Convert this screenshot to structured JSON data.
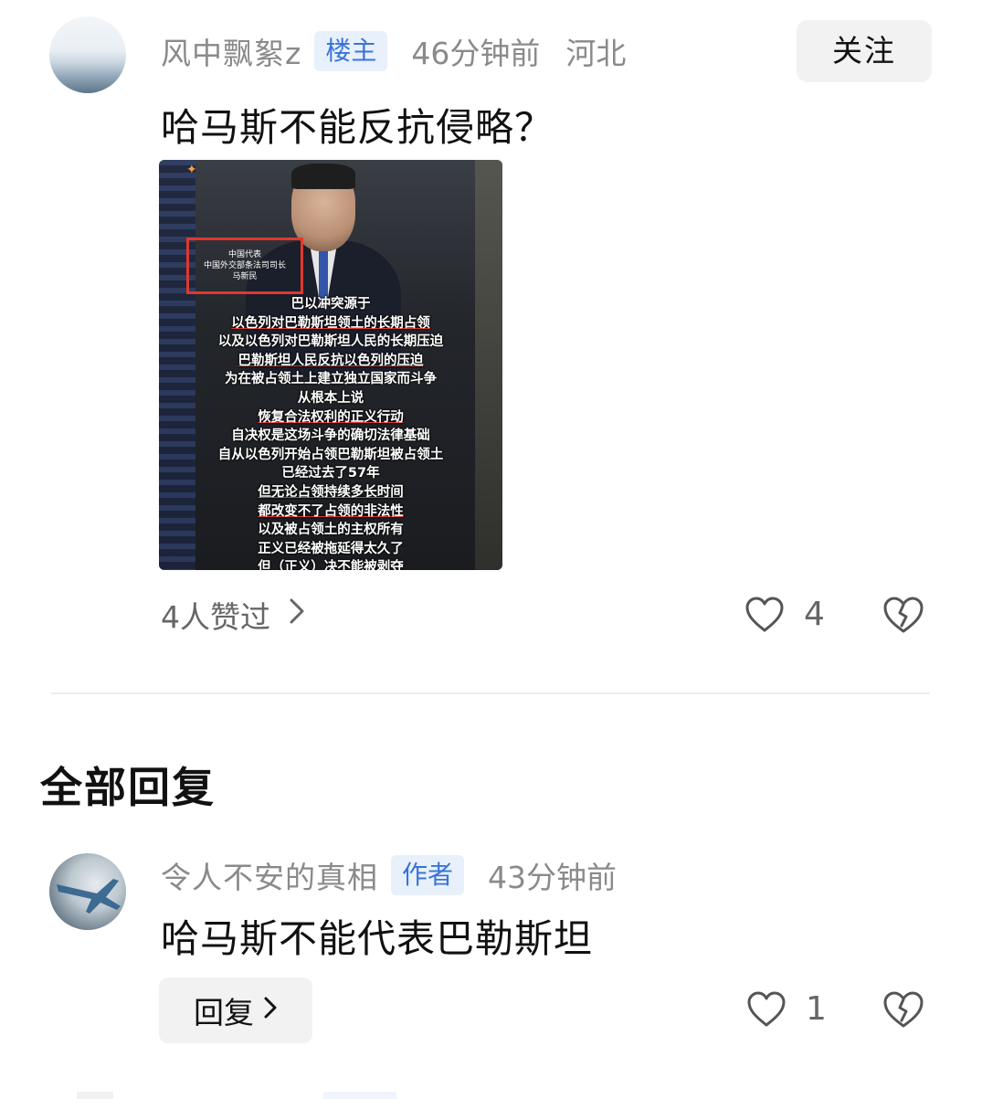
{
  "post": {
    "username": "风中飘絮z",
    "badge": "楼主",
    "time": "46分钟前",
    "location": "河北",
    "follow_label": "关注",
    "text": "哈马斯不能反抗侵略？",
    "image": {
      "label_lines": [
        "中国代表",
        "中国外交部条法司司长",
        "马新民"
      ],
      "subtitle_lines": [
        "巴以冲突源于",
        "以色列对巴勒斯坦领土的长期占领",
        "以及以色列对巴勒斯坦人民的长期压迫",
        "巴勒斯坦人民反抗以色列的压迫",
        "为在被占领土上建立独立国家而斗争",
        "从根本上说",
        "恢复合法权利的正义行动",
        "自决权是这场斗争的确切法律基础",
        "自从以色列开始占领巴勒斯坦被占领土",
        "已经过去了57年",
        "但无论占领持续多长时间",
        "都改变不了占领的非法性",
        "以及被占领土的主权所有",
        "正义已经被拖延得太久了",
        "但（正义）决不能被剥夺"
      ]
    },
    "likes_label": "4人赞过",
    "like_count": "4",
    "chevron": "›"
  },
  "replies": {
    "section_title": "全部回复",
    "items": [
      {
        "username": "令人不安的真相",
        "badge": "作者",
        "time": "43分钟前",
        "text": "哈马斯不能代表巴勒斯坦",
        "reply_label": "回复",
        "like_count": "1"
      }
    ]
  },
  "icons": {
    "heart": "heart-icon",
    "broken_heart": "broken-heart-icon",
    "chevron": "chevron-right-icon"
  },
  "colors": {
    "badge_bg": "#e8f0fb",
    "badge_text": "#3a73d8",
    "meta_text": "#8a8a8a",
    "label_border": "#e0382e"
  }
}
